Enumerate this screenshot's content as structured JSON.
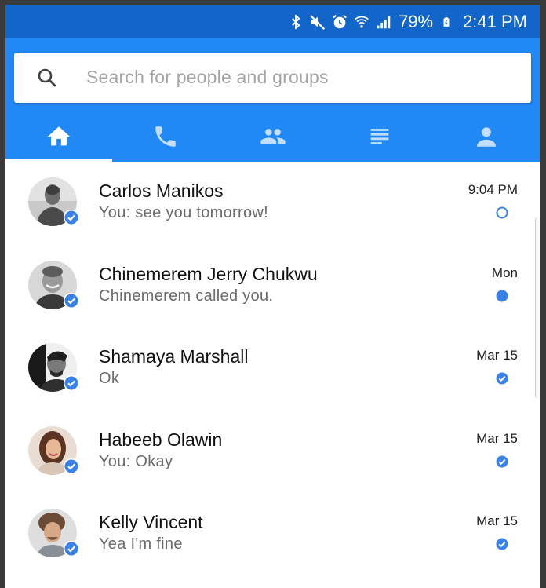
{
  "status_bar": {
    "battery": "79%",
    "time": "2:41 PM",
    "icons": [
      "bluetooth-icon",
      "mute-icon",
      "alarm-icon",
      "wifi-icon",
      "signal-icon",
      "battery-icon"
    ]
  },
  "search": {
    "placeholder": "Search for people and groups"
  },
  "tabs": [
    {
      "icon": "home-icon",
      "active": true
    },
    {
      "icon": "phone-icon",
      "active": false
    },
    {
      "icon": "people-icon",
      "active": false
    },
    {
      "icon": "list-icon",
      "active": false
    },
    {
      "icon": "person-icon",
      "active": false
    }
  ],
  "conversations": [
    {
      "name": "Carlos Manikos",
      "preview": "You: see you tomorrow!",
      "time": "9:04 PM",
      "status": "sent-circle"
    },
    {
      "name": "Chinemerem Jerry Chukwu",
      "preview": "Chinemerem called you.",
      "time": "Mon",
      "status": "unread-dot"
    },
    {
      "name": "Shamaya Marshall",
      "preview": "Ok",
      "time": "Mar 15",
      "status": "delivered-check"
    },
    {
      "name": "Habeeb Olawin",
      "preview": "You: Okay",
      "time": "Mar 15",
      "status": "delivered-check"
    },
    {
      "name": "Kelly Vincent",
      "preview": "Yea I'm fine",
      "time": "Mar 15",
      "status": "delivered-check"
    }
  ],
  "colors": {
    "status_bar": "#1266c9",
    "app_bar": "#2089f6",
    "accent": "#3b82e8"
  }
}
